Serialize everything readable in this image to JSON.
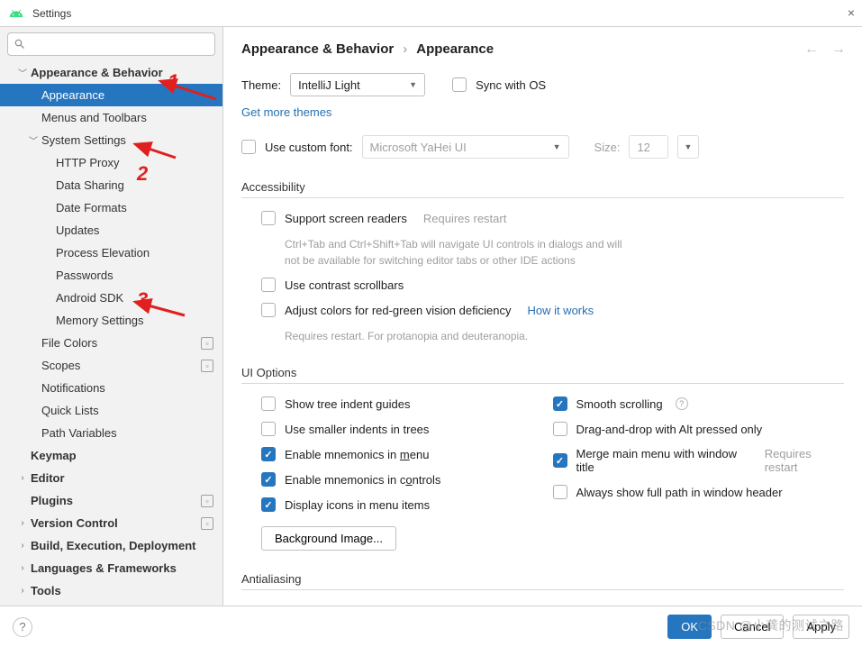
{
  "window": {
    "title": "Settings"
  },
  "breadcrumb": {
    "a": "Appearance & Behavior",
    "b": "Appearance"
  },
  "sidebar": {
    "items": [
      {
        "label": "Appearance & Behavior"
      },
      {
        "label": "Appearance"
      },
      {
        "label": "Menus and Toolbars"
      },
      {
        "label": "System Settings"
      },
      {
        "label": "HTTP Proxy"
      },
      {
        "label": "Data Sharing"
      },
      {
        "label": "Date Formats"
      },
      {
        "label": "Updates"
      },
      {
        "label": "Process Elevation"
      },
      {
        "label": "Passwords"
      },
      {
        "label": "Android SDK"
      },
      {
        "label": "Memory Settings"
      },
      {
        "label": "File Colors"
      },
      {
        "label": "Scopes"
      },
      {
        "label": "Notifications"
      },
      {
        "label": "Quick Lists"
      },
      {
        "label": "Path Variables"
      },
      {
        "label": "Keymap"
      },
      {
        "label": "Editor"
      },
      {
        "label": "Plugins"
      },
      {
        "label": "Version Control"
      },
      {
        "label": "Build, Execution, Deployment"
      },
      {
        "label": "Languages & Frameworks"
      },
      {
        "label": "Tools"
      }
    ]
  },
  "theme": {
    "label": "Theme:",
    "value": "IntelliJ Light",
    "sync": "Sync with OS",
    "more": "Get more themes"
  },
  "font": {
    "use_label": "Use custom font:",
    "family": "Microsoft YaHei UI",
    "size_label": "Size:",
    "size": "12"
  },
  "accessibility": {
    "title": "Accessibility",
    "screen_readers": "Support screen readers",
    "requires_restart": "Requires restart",
    "hint": "Ctrl+Tab and Ctrl+Shift+Tab will navigate UI controls in dialogs and will not be available for switching editor tabs or other IDE actions",
    "contrast": "Use contrast scrollbars",
    "rg": "Adjust colors for red-green vision deficiency",
    "how": "How it works",
    "rg_hint": "Requires restart. For protanopia and deuteranopia."
  },
  "ui": {
    "title": "UI Options",
    "tree_indent": "Show tree indent guides",
    "small_indent": "Use smaller indents in trees",
    "mnem_menu": "Enable mnemonics in menu",
    "mnem_ctrl": "Enable mnemonics in controls",
    "icons_menu": "Display icons in menu items",
    "smooth": "Smooth scrolling",
    "dnd": "Drag-and-drop with Alt pressed only",
    "merge": "Merge main menu with window title",
    "fullpath": "Always show full path in window header",
    "bg_btn": "Background Image..."
  },
  "aa": {
    "title": "Antialiasing"
  },
  "footer": {
    "ok": "OK",
    "cancel": "Cancel",
    "apply": "Apply"
  },
  "annotations": {
    "n1": "1",
    "n2": "2",
    "n3": "3"
  },
  "watermark": "CSDN @小龚的测试之路"
}
